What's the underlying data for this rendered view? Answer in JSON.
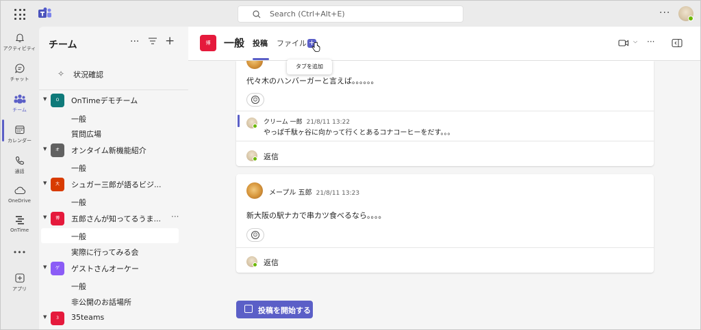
{
  "app": {
    "accent": "#5b5fc7",
    "presence_color": "#6bb700"
  },
  "topbar": {
    "search_placeholder": "Search (Ctrl+Alt+E)",
    "more_icon": "more-dots-icon"
  },
  "rail": {
    "items": [
      {
        "label": "アクティビティ",
        "icon": "bell-icon"
      },
      {
        "label": "チャット",
        "icon": "chat-icon"
      },
      {
        "label": "チーム",
        "icon": "teams-icon",
        "active": true
      },
      {
        "label": "カレンダー",
        "icon": "calendar-icon"
      },
      {
        "label": "通話",
        "icon": "phone-icon"
      },
      {
        "label": "OneDrive",
        "icon": "cloud-icon"
      },
      {
        "label": "OnTime",
        "icon": "ontime-icon"
      },
      {
        "label": "•••",
        "icon": "more-apps-icon"
      },
      {
        "label": "アプリ",
        "icon": "add-app-icon"
      }
    ]
  },
  "sidebar": {
    "title": "チーム",
    "status_item": "状況確認",
    "teams": [
      {
        "name": "OnTimeデモチーム",
        "avatar_text": "O",
        "color": "#0f7a7a",
        "channels": [
          "一般",
          "質問広場"
        ]
      },
      {
        "name": "オンタイム新機能紹介",
        "avatar_text": "オ",
        "color": "#616161",
        "channels": [
          "一般"
        ]
      },
      {
        "name": "シュガー三郎が語るビジ...",
        "avatar_text": "大",
        "color": "#d83b01",
        "channels": [
          "一般"
        ]
      },
      {
        "name": "五郎さんが知ってるうま...",
        "avatar_text": "博",
        "color": "#e51a3c",
        "channels": [
          "一般",
          "実際に行ってみる会"
        ],
        "selected_channel": 0
      },
      {
        "name": "ゲストさんオーケー",
        "avatar_text": "ゲ",
        "color": "#8b5cf6",
        "channels": [
          "一般",
          "非公開のお話場所"
        ]
      },
      {
        "name": "35teams",
        "avatar_text": "3",
        "color": "#e51a3c",
        "channels": []
      }
    ]
  },
  "header": {
    "avatar_text": "博",
    "title": "一般",
    "tabs": [
      "投稿",
      "ファイル"
    ],
    "add_tab_symbol": "+",
    "tooltip": "タブを追加",
    "more": "···"
  },
  "posts": [
    {
      "text": "代々木のハンバーガーと言えば。。。。。。",
      "reply": {
        "author": "クリーム 一郎",
        "time": "21/8/11 13:22",
        "text": "やっぱ千駄ヶ谷に向かって行くとあるコナコーヒーをだす。。。"
      },
      "reply_label": "返信"
    },
    {
      "author": "メープル 五郎",
      "time": "21/8/11 13:23",
      "text": "新大阪の駅ナカで串カツ食べるなら。。。。",
      "reply_label": "返信"
    }
  ],
  "compose": {
    "start_label": "投稿を開始する"
  }
}
